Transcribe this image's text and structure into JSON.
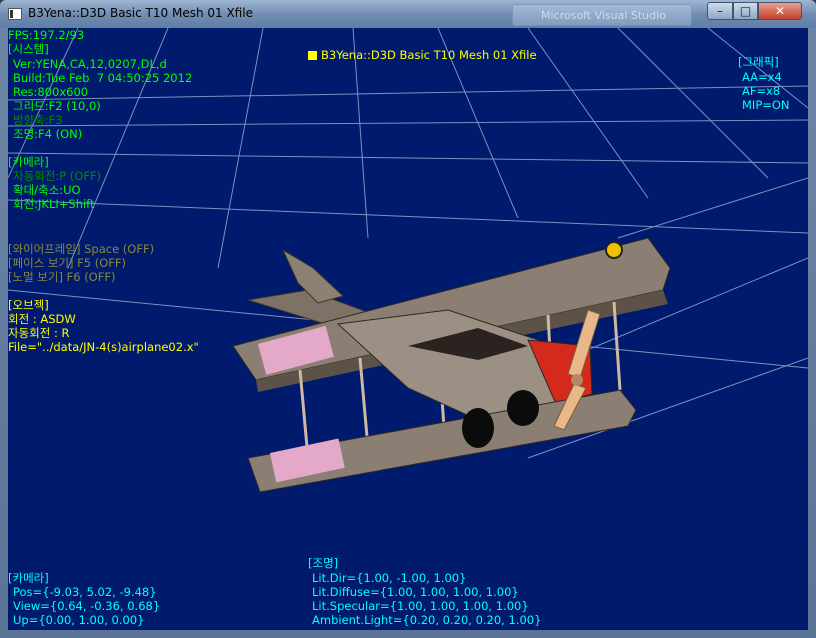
{
  "window": {
    "title": "B3Yena::D3D Basic T10 Mesh 01 Xfile",
    "background_tab": "Microsoft Visual Studio",
    "buttons": {
      "minimize": "–",
      "maximize": "□",
      "close": "✕"
    }
  },
  "hud": {
    "fps": "FPS:197.2/93",
    "caption": "B3Yena::D3D Basic T10 Mesh 01 Xfile",
    "system": {
      "header": "[시스템]",
      "ver": "Ver:YENA,CA,12,0207,DL,d",
      "build": "Build:Tue Feb  7 04:50:25 2012",
      "res": "Res:800x600",
      "grid": "그리드:F2 (10,0)",
      "axis": "방향축:F3",
      "light": "조명:F4 (ON)"
    },
    "camera_keys": {
      "header": "[카메라]",
      "autorotate": "자동회전:P (OFF)",
      "zoom": "확대/축소:UO",
      "rotate": "회전:JKLI+Shift"
    },
    "render_modes": {
      "wireframe": "[와이어프레임] Space (OFF)",
      "face": "[페이스 보기] F5 (OFF)",
      "normal": "[노멀 보기] F6 (OFF)"
    },
    "object": {
      "header": "[오브젝]",
      "rotate": "회전 : ASDW",
      "autorotate": "자동회전 : R",
      "file": "File=\"../data/JN-4(s)airplane02.x\""
    },
    "graphics": {
      "header": "[그래픽]",
      "aa": "AA=x4",
      "af": "AF=x8",
      "mip": "MIP=ON"
    },
    "camera_state": {
      "header": "[카메라]",
      "pos": "Pos={-9.03, 5.02, -9.48}",
      "view": "View={0.64, -0.36, 0.68}",
      "up": "Up={0.00, 1.00, 0.00}"
    },
    "lighting": {
      "header": "[조명]",
      "dir": "Lit.Dir={1.00, -1.00, 1.00}",
      "diffuse": "Lit.Diffuse={1.00, 1.00, 1.00, 1.00}",
      "specular": "Lit.Specular={1.00, 1.00, 1.00, 1.00}",
      "ambient": "Ambient.Light={0.20, 0.20, 0.20, 1.00}"
    }
  },
  "scene": {
    "object": "biplane-model",
    "colors": {
      "background": "#001a6d",
      "grid": "#a9b8dd",
      "wing": "#8b7f73",
      "fuselage": "#9c8f84",
      "propeller": "#e8b78a",
      "nose": "#d42a1c"
    }
  }
}
